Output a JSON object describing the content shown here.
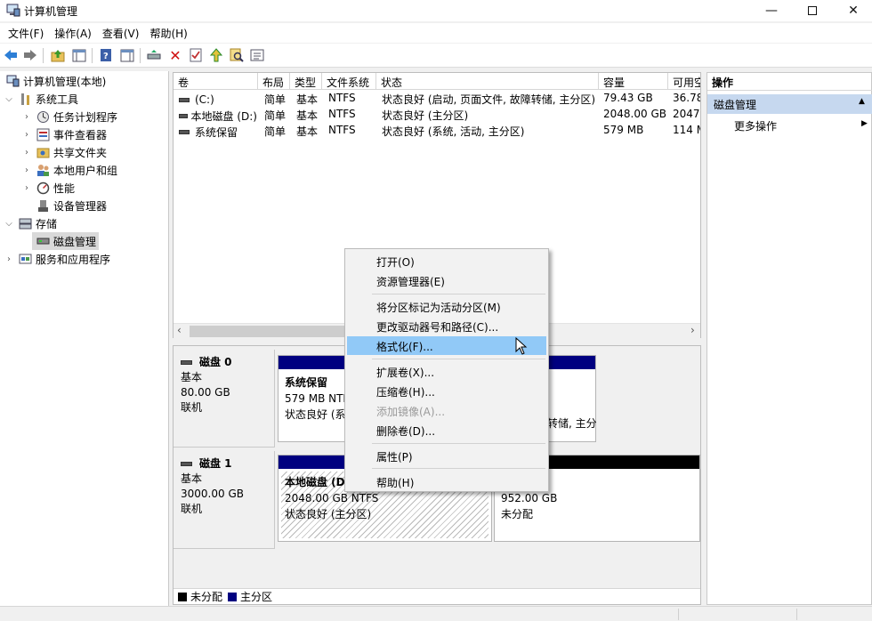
{
  "window": {
    "title": "计算机管理"
  },
  "menu": [
    "文件(F)",
    "操作(A)",
    "查看(V)",
    "帮助(H)"
  ],
  "tree": {
    "root": "计算机管理(本地)",
    "system_tools": "系统工具",
    "task_scheduler": "任务计划程序",
    "event_viewer": "事件查看器",
    "shared_folders": "共享文件夹",
    "local_users": "本地用户和组",
    "performance": "性能",
    "device_manager": "设备管理器",
    "storage": "存储",
    "disk_management": "磁盘管理",
    "services_apps": "服务和应用程序"
  },
  "volumes": {
    "columns": [
      "卷",
      "布局",
      "类型",
      "文件系统",
      "状态",
      "容量",
      "可用空"
    ],
    "rows": [
      {
        "name": "(C:)",
        "layout": "简单",
        "type": "基本",
        "fs": "NTFS",
        "status": "状态良好 (启动, 页面文件, 故障转储, 主分区)",
        "capacity": "79.43 GB",
        "free": "36.78"
      },
      {
        "name": "本地磁盘 (D:)",
        "layout": "简单",
        "type": "基本",
        "fs": "NTFS",
        "status": "状态良好 (主分区)",
        "capacity": "2048.00 GB",
        "free": "2047.8"
      },
      {
        "name": "系统保留",
        "layout": "简单",
        "type": "基本",
        "fs": "NTFS",
        "status": "状态良好 (系统, 活动, 主分区)",
        "capacity": "579 MB",
        "free": "114 M"
      }
    ]
  },
  "disks": [
    {
      "name": "磁盘 0",
      "type": "基本",
      "size": "80.00 GB",
      "state": "联机",
      "p1": {
        "name": "系统保留",
        "size": "579 MB NTF",
        "status": "状态良好 (系"
      },
      "p2": {
        "status": "转储, 主分"
      }
    },
    {
      "name": "磁盘 1",
      "type": "基本",
      "size": "3000.00 GB",
      "state": "联机",
      "p1": {
        "name": "本地磁盘 (D",
        "size": "2048.00 GB NTFS",
        "status": "状态良好 (主分区)"
      },
      "p2": {
        "size": "952.00 GB",
        "status": "未分配"
      }
    }
  ],
  "legend": {
    "unallocated": "未分配",
    "primary": "主分区"
  },
  "colors": {
    "primary": "#000080",
    "unallocated": "#000000",
    "highlight": "#91c9f7",
    "action_section": "#c6d8ef"
  },
  "actions": {
    "header": "操作",
    "section": "磁盘管理",
    "more": "更多操作"
  },
  "context_menu": {
    "open": "打开(O)",
    "explore": "资源管理器(E)",
    "mark_active": "将分区标记为活动分区(M)",
    "change_letter": "更改驱动器号和路径(C)...",
    "format": "格式化(F)...",
    "extend": "扩展卷(X)...",
    "shrink": "压缩卷(H)...",
    "add_mirror": "添加镜像(A)...",
    "delete": "删除卷(D)...",
    "properties": "属性(P)",
    "help": "帮助(H)"
  }
}
